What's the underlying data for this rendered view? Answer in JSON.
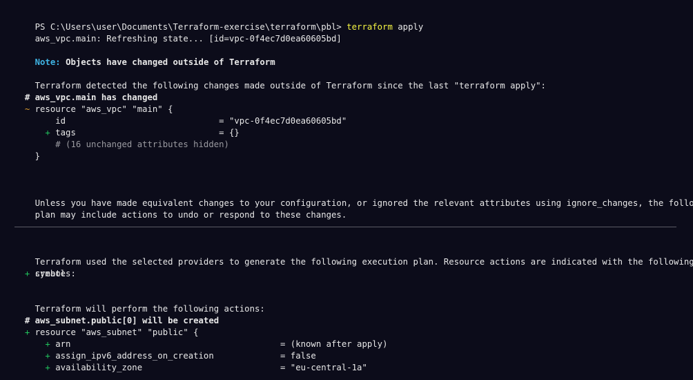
{
  "prompt": {
    "path": "PS C:\\Users\\user\\Documents\\Terraform-exercise\\terraform\\pbl>",
    "command": "terraform",
    "args": "apply"
  },
  "lines": {
    "refresh": "aws_vpc.main: Refreshing state... [id=vpc-0f4ec7d0ea60605bd]",
    "note_label": "Note:",
    "note_text": "Objects have changed outside of Terraform",
    "detected": "Terraform detected the following changes made outside of Terraform since the last \"terraform apply\":",
    "changed_comment": "# aws_vpc.main has changed",
    "tilde": "~",
    "resource_vpc": "resource \"aws_vpc\" \"main\" {",
    "vpc_id_key": "id",
    "vpc_id_val": "= \"vpc-0f4ec7d0ea60605bd\"",
    "plus": "+",
    "tags_key": "tags",
    "tags_val": "= {}",
    "hidden": "# (16 unchanged attributes hidden)",
    "close_brace": "}",
    "unless_1": "Unless you have made equivalent changes to your configuration, or ignored the relevant attributes using ignore_changes, the following",
    "unless_2": "plan may include actions to undo or respond to these changes.",
    "used_1": "Terraform used the selected providers to generate the following execution plan. Resource actions are indicated with the following",
    "used_2": "symbols:",
    "create": "create",
    "perform": "Terraform will perform the following actions:",
    "subnet_comment": "# aws_subnet.public[0] will be created",
    "resource_subnet": "resource \"aws_subnet\" \"public\" {",
    "arn_key": "arn",
    "arn_val": "= (known after apply)",
    "ipv6_key": "assign_ipv6_address_on_creation",
    "ipv6_val": "= false",
    "az_key": "availability_zone",
    "az_val": "= \"eu-central-1a\""
  },
  "colors": {
    "background": "#0c0c1a",
    "text": "#e8e8e8",
    "plus": "#21c55d",
    "tilde": "#e0a030",
    "command": "#f5f543",
    "note": "#3fb4e4",
    "comment": "#9a9aa0"
  }
}
